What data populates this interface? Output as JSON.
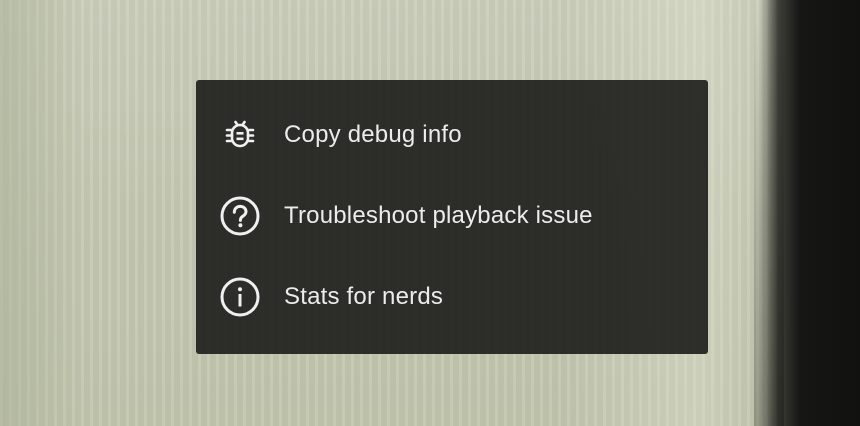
{
  "menu": {
    "items": [
      {
        "icon": "bug-icon",
        "label": "Copy debug info"
      },
      {
        "icon": "help-circle-icon",
        "label": "Troubleshoot playback issue"
      },
      {
        "icon": "info-circle-icon",
        "label": "Stats for nerds"
      }
    ]
  },
  "colors": {
    "menu_background": "#1c1c1a",
    "text": "#ececec"
  }
}
